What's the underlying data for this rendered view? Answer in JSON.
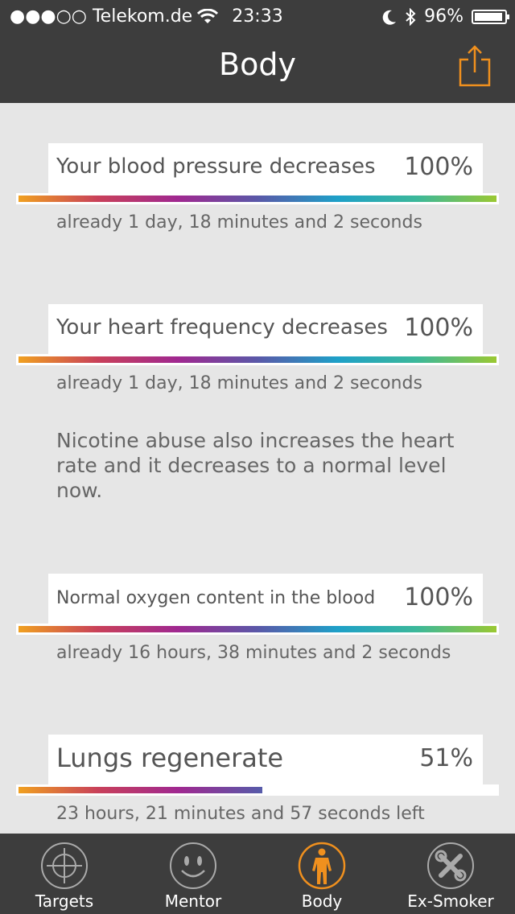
{
  "status_bar": {
    "carrier": "●●●○○ Telekom.de",
    "time": "23:33",
    "battery": "96%",
    "battery_level": 0.96
  },
  "nav": {
    "title": "Body",
    "share_icon": "share-icon"
  },
  "cards": [
    {
      "label": "Your blood pressure decreases",
      "percent": "100%",
      "progress": 1.0,
      "meta": "already 1 day, 18 minutes and 2 seconds"
    },
    {
      "label": "Your heart frequency decreases",
      "percent": "100%",
      "progress": 1.0,
      "meta": "already 1 day, 18 minutes and 2 seconds",
      "note": "Nicotine abuse also increases the heart rate and it decreases to a normal level now."
    },
    {
      "label": "Normal oxygen content in the blood",
      "percent": "100%",
      "progress": 1.0,
      "meta": "already 16 hours, 38 minutes and 2 seconds"
    },
    {
      "label": "Lungs regenerate",
      "percent": "51%",
      "progress": 0.51,
      "meta": "23 hours, 21 minutes and 57 seconds left"
    }
  ],
  "tabs": [
    {
      "label": "Targets",
      "icon": "crosshair-icon"
    },
    {
      "label": "Mentor",
      "icon": "smiley-icon"
    },
    {
      "label": "Body",
      "icon": "body-icon",
      "active": true
    },
    {
      "label": "Ex-Smoker",
      "icon": "tools-icon"
    }
  ],
  "colors": {
    "bar_dark": "#3d3d3d",
    "accent": "#f0901e",
    "gradient": [
      "#f0a020",
      "#c8405a",
      "#a02890",
      "#5a58a8",
      "#1ea0c8",
      "#3cb89a",
      "#9ac832"
    ]
  }
}
